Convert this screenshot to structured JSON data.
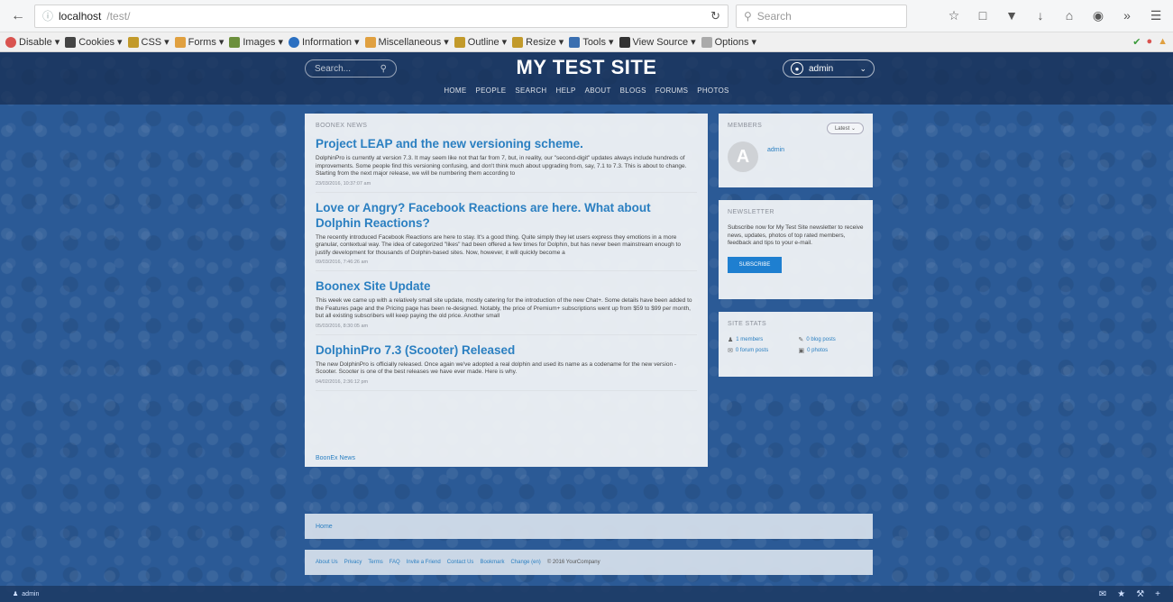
{
  "browser": {
    "url_host": "localhost",
    "url_path": "/test/",
    "search_placeholder": "Search"
  },
  "devbar": {
    "items": [
      "Disable",
      "Cookies",
      "CSS",
      "Forms",
      "Images",
      "Information",
      "Miscellaneous",
      "Outline",
      "Resize",
      "Tools",
      "View Source",
      "Options"
    ]
  },
  "site": {
    "title": "MY TEST SITE",
    "search_placeholder": "Search...",
    "account_name": "admin",
    "nav": [
      "HOME",
      "PEOPLE",
      "SEARCH",
      "HELP",
      "ABOUT",
      "BLOGS",
      "FORUMS",
      "PHOTOS"
    ]
  },
  "news": {
    "label": "BOONEX NEWS",
    "posts": [
      {
        "title": "Project LEAP and the new versioning scheme.",
        "body": "DolphinPro is currently at version 7.3. It may seem like not that far from 7, but, in reality, our \"second-digit\" updates always include hundreds of improvements. Some people find this versioning confusing, and don't think much about upgrading from, say, 7.1 to 7.3. This is about to change. Starting from the next major release, we will be numbering them according to",
        "date": "23/03/2016, 10:37:07 am"
      },
      {
        "title": "Love or Angry? Facebook Reactions are here. What about Dolphin Reactions?",
        "body": "The recently introduced Facebook Reactions are here to stay. It's a good thing. Quite simply they let users express they emotions in a more granular, contextual way. The idea of categorized \"likes\" had been offered a few times for Dolphin, but has never been mainstream enough to justify development for thousands of Dolphin-based sites. Now, however, it will quickly become a",
        "date": "09/03/2016, 7:46:26 am"
      },
      {
        "title": "Boonex Site Update",
        "body": "This week we came up with a relatively small site update, mostly catering for the introduction of the new Chat+. Some details have been added to the Features page and the Pricing page has been re-designed. Notably, the price of Premium+ subscriptions went up from $59 to $99 per month, but all existing subscribers will keep paying the old price. Another small",
        "date": "05/03/2016, 8:30:05 am"
      },
      {
        "title": "DolphinPro 7.3 (Scooter) Released",
        "body": "The new DolphinPro is officially released. Once again we've adopted a real dolphin and used its name as a codename for the new version - Scooter. Scooter is one of the best releases we have ever made. Here is why.",
        "date": "04/02/2016, 2:36:12 pm"
      }
    ],
    "more_link": "BoonEx News"
  },
  "members": {
    "label": "MEMBERS",
    "filter": "Latest",
    "avatar_letter": "A",
    "name": "admin"
  },
  "newsletter": {
    "label": "NEWSLETTER",
    "text": "Subscribe now for My Test Site newsletter to receive news, updates, photos of top rated members, feedback and tips to your e-mail.",
    "button": "SUBSCRIBE"
  },
  "stats": {
    "label": "SITE STATS",
    "items": [
      "1 members",
      "0 blog posts",
      "0 forum posts",
      "0 photos"
    ]
  },
  "breadcrumb": {
    "home": "Home"
  },
  "footer": {
    "links": [
      "About Us",
      "Privacy",
      "Terms",
      "FAQ",
      "Invite a Friend",
      "Contact Us",
      "Bookmark",
      "Change (en)"
    ],
    "copyright": "© 2016 YourCompany"
  },
  "bottom": {
    "user": "admin"
  }
}
